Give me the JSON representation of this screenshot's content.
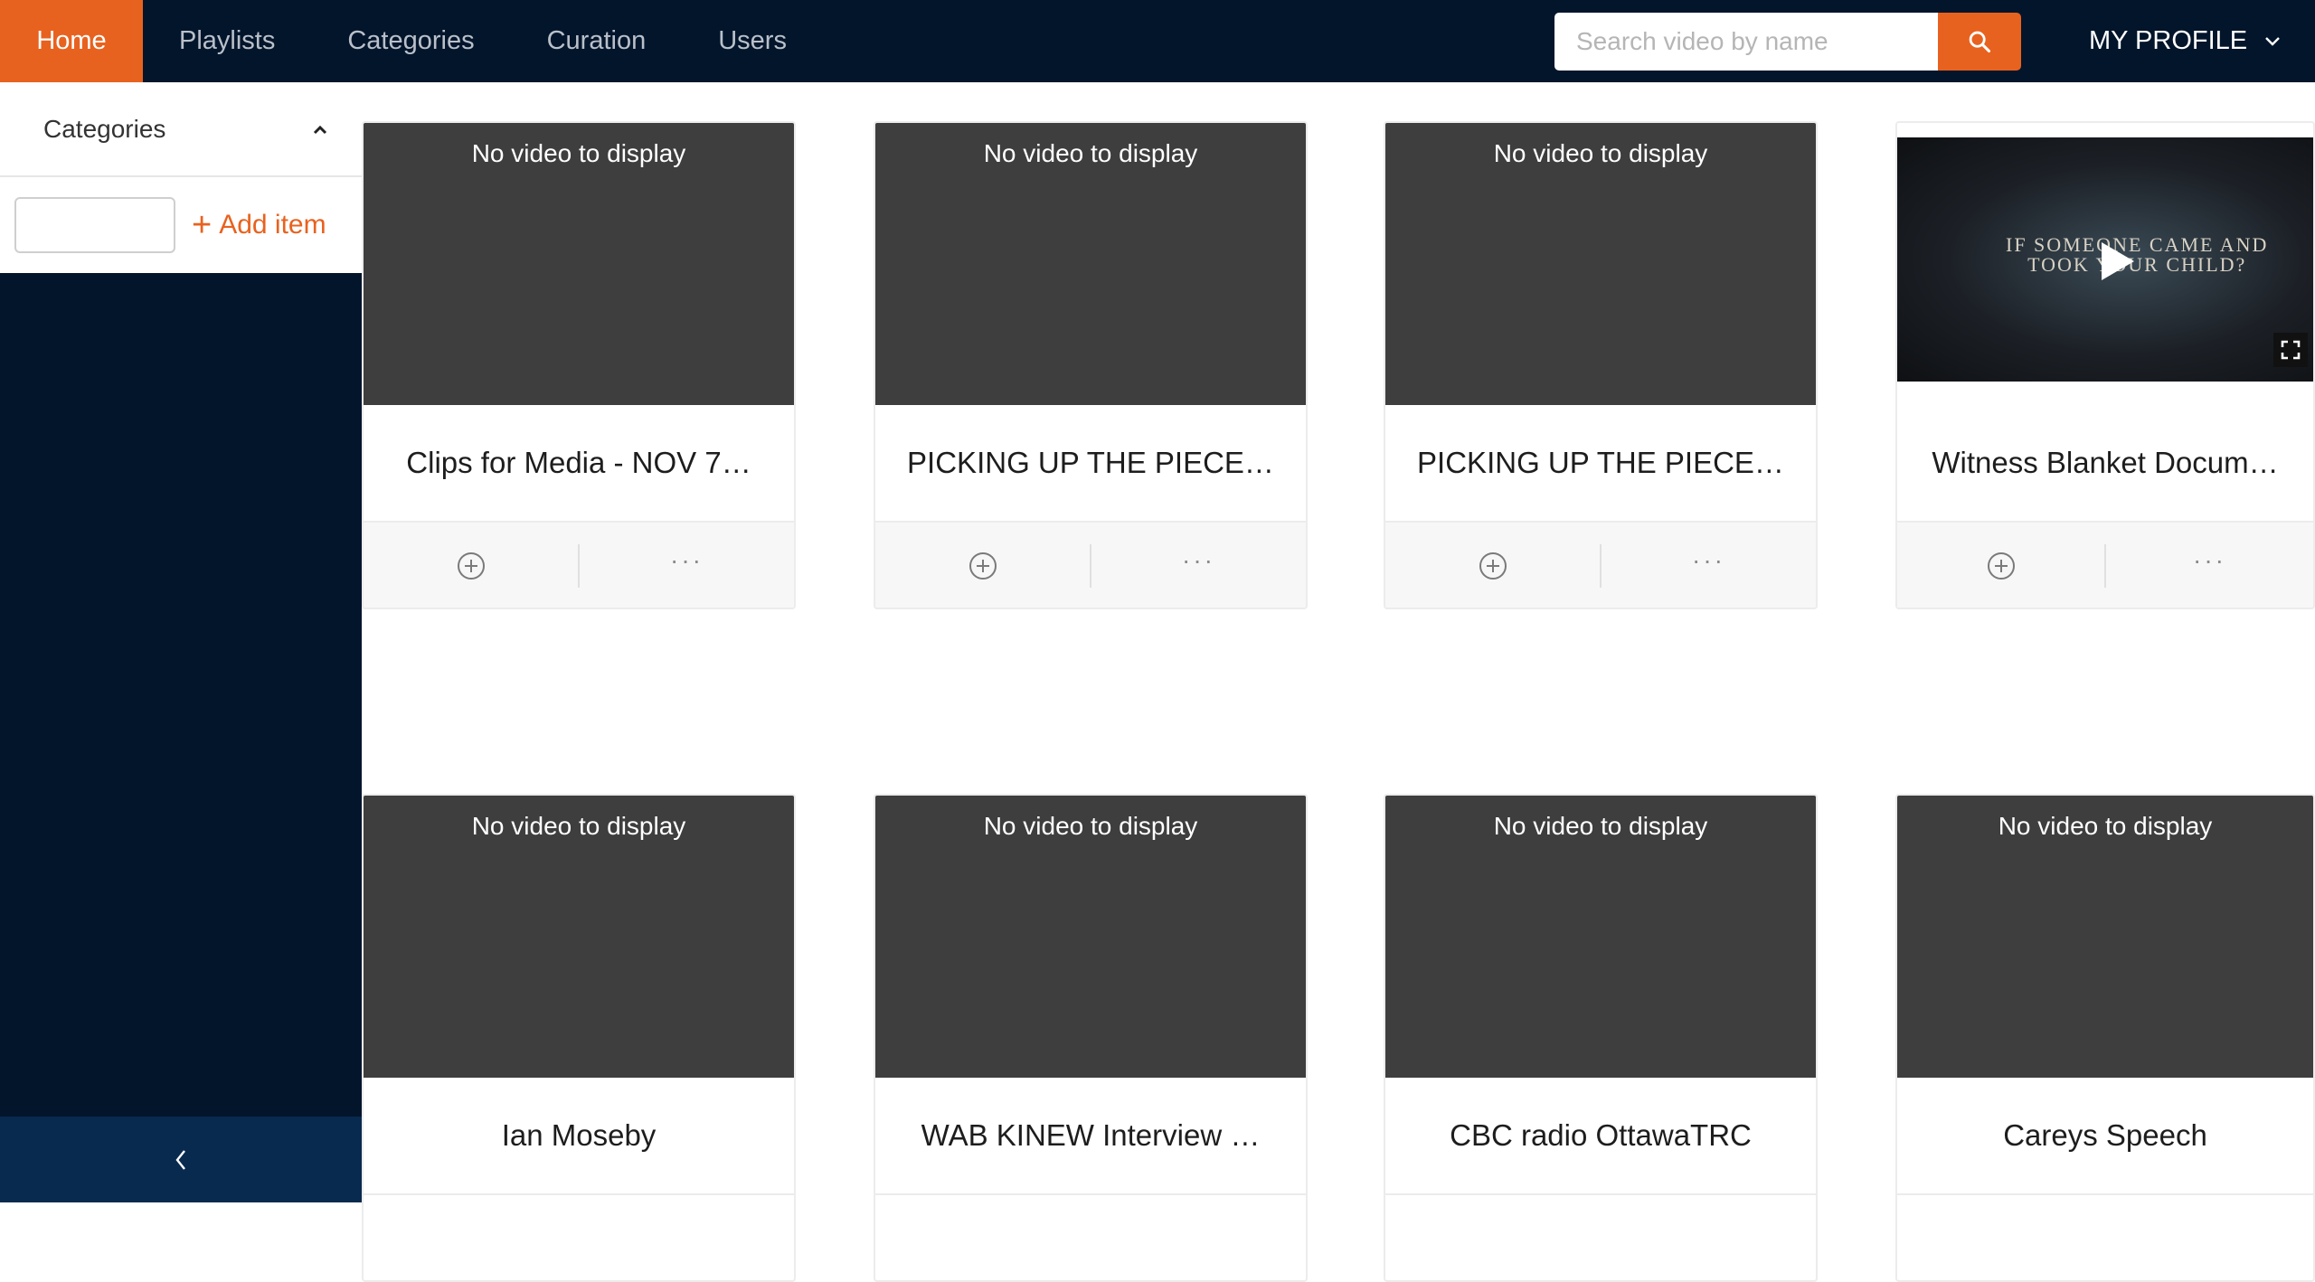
{
  "nav": {
    "items": [
      {
        "label": "Home",
        "active": true
      },
      {
        "label": "Playlists",
        "active": false
      },
      {
        "label": "Categories",
        "active": false
      },
      {
        "label": "Curation",
        "active": false
      },
      {
        "label": "Users",
        "active": false
      }
    ],
    "search_placeholder": "Search video by name",
    "profile_label": "MY PROFILE"
  },
  "sidebar": {
    "categories_label": "Categories",
    "add_input_value": "",
    "add_item_label": "Add item"
  },
  "cards": [
    {
      "title": "Clips for Media - NOV 7…",
      "thumb_text": "No video to display"
    },
    {
      "title": "PICKING UP THE PIECE…",
      "thumb_text": "No video to display"
    },
    {
      "title": "PICKING UP THE PIECE…",
      "thumb_text": "No video to display"
    },
    {
      "title": "Witness Blanket Docum…",
      "thumb_text": "",
      "video_overlay": [
        "IF SOMEONE CAME AND",
        "TOOK YOUR CHILD?"
      ]
    },
    {
      "title": "Ian Moseby",
      "thumb_text": "No video to display"
    },
    {
      "title": "WAB KINEW Interview …",
      "thumb_text": "No video to display"
    },
    {
      "title": "CBC radio OttawaTRC",
      "thumb_text": "No video to display"
    },
    {
      "title": "Careys Speech",
      "thumb_text": "No video to display"
    }
  ],
  "colors": {
    "accent": "#e8621f",
    "navbar": "#03152b",
    "thumb_placeholder": "#3e3e3e"
  },
  "icons": {
    "search": "search-icon",
    "profile_dropdown": "chevron-down-icon",
    "categories_toggle": "chevron-up-icon",
    "add": "plus-icon",
    "collapse": "chevron-left-icon",
    "add_to_playlist": "plus-circle-icon",
    "more": "more-icon",
    "play": "play-icon",
    "fullscreen": "fullscreen-icon"
  }
}
